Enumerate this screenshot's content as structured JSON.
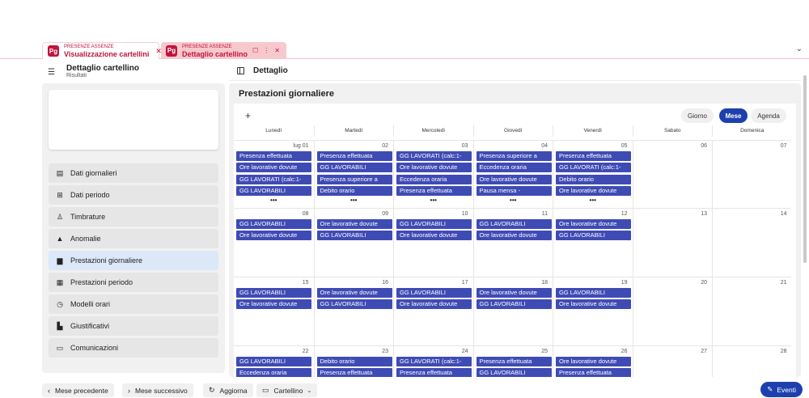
{
  "tabs": [
    {
      "sub": "PRESENZE ASSENZE",
      "main": "Visualizzazione cartellini",
      "logo": "Pg"
    },
    {
      "sub": "PRESENZE ASSENZE",
      "main": "Dettaglio cartellino",
      "logo": "Pg"
    }
  ],
  "header": {
    "title": "Dettaglio cartellino",
    "subtitle": "Risultati",
    "detail_title": "Dettaglio"
  },
  "sidebar": {
    "items": [
      {
        "label": "Dati giornalieri",
        "icon": "clipboard-icon",
        "glyph": "▤"
      },
      {
        "label": "Dati periodo",
        "icon": "table-icon",
        "glyph": "⊞"
      },
      {
        "label": "Timbrature",
        "icon": "person-badge-icon",
        "glyph": "♙"
      },
      {
        "label": "Anomalie",
        "icon": "warning-icon",
        "glyph": "▲"
      },
      {
        "label": "Prestazioni giornaliere",
        "icon": "document-icon",
        "glyph": "▆",
        "active": true
      },
      {
        "label": "Prestazioni periodo",
        "icon": "calendar-icon",
        "glyph": "▦"
      },
      {
        "label": "Modelli orari",
        "icon": "clock-calendar-icon",
        "glyph": "◷"
      },
      {
        "label": "Giustificativi",
        "icon": "file-check-icon",
        "glyph": "▙"
      },
      {
        "label": "Comunicazioni",
        "icon": "message-icon",
        "glyph": "▭"
      }
    ]
  },
  "main": {
    "title": "Prestazioni giornaliere",
    "views": [
      "Giorno",
      "Mese",
      "Agenda"
    ],
    "active_view": "Mese",
    "days_of_week": [
      "Lunedì",
      "Martedì",
      "Mercoledì",
      "Giovedì",
      "Venerdì",
      "Sabato",
      "Domenica"
    ],
    "weeks": [
      {
        "days": [
          {
            "num": "lug 01",
            "events": [
              "Presenza effettuata",
              "Ore lavorative dovute",
              "GG LAVORATI (calc:1-",
              "GG LAVORABILI"
            ],
            "more": "•••"
          },
          {
            "num": "02",
            "events": [
              "Presenza effettuata",
              "GG LAVORABILI",
              "Presenza superiore a",
              "Debito orario"
            ],
            "more": "•••"
          },
          {
            "num": "03",
            "events": [
              "GG LAVORATI (calc:1-",
              "Ore lavorative dovute",
              "Eccedenza oraria",
              "Presenza effettuata"
            ],
            "more": "•••"
          },
          {
            "num": "04",
            "events": [
              "Presenza superiore a",
              "Eccedenza oraria",
              "Ore lavorative dovute",
              "Pausa mensa -"
            ],
            "more": "•••"
          },
          {
            "num": "05",
            "events": [
              "Presenza effettuata",
              "GG LAVORATI (calc:1-",
              "Debito orario",
              "Ore lavorative dovute"
            ],
            "more": "•••"
          },
          {
            "num": "06",
            "events": []
          },
          {
            "num": "07",
            "events": []
          }
        ]
      },
      {
        "days": [
          {
            "num": "08",
            "events": [
              "GG LAVORABILI",
              "Ore lavorative dovute"
            ]
          },
          {
            "num": "09",
            "events": [
              "Ore lavorative dovute",
              "GG LAVORABILI"
            ]
          },
          {
            "num": "10",
            "events": [
              "GG LAVORABILI",
              "Ore lavorative dovute"
            ]
          },
          {
            "num": "11",
            "events": [
              "GG LAVORABILI",
              "Ore lavorative dovute"
            ]
          },
          {
            "num": "12",
            "events": [
              "Ore lavorative dovute",
              "GG LAVORABILI"
            ]
          },
          {
            "num": "13",
            "events": []
          },
          {
            "num": "14",
            "events": []
          }
        ]
      },
      {
        "days": [
          {
            "num": "15",
            "events": [
              "GG LAVORABILI",
              "Ore lavorative dovute"
            ]
          },
          {
            "num": "16",
            "events": [
              "Ore lavorative dovute",
              "GG LAVORABILI"
            ]
          },
          {
            "num": "17",
            "events": [
              "GG LAVORABILI",
              "Ore lavorative dovute"
            ]
          },
          {
            "num": "18",
            "events": [
              "Ore lavorative dovute",
              "GG LAVORABILI"
            ]
          },
          {
            "num": "19",
            "events": [
              "GG LAVORABILI",
              "Ore lavorative dovute"
            ]
          },
          {
            "num": "20",
            "events": []
          },
          {
            "num": "21",
            "events": []
          }
        ]
      },
      {
        "days": [
          {
            "num": "22",
            "events": [
              "GG LAVORABILI",
              "Eccedenza oraria"
            ]
          },
          {
            "num": "23",
            "events": [
              "Debito orario",
              "Presenza effettuata"
            ]
          },
          {
            "num": "24",
            "events": [
              "GG LAVORATI (calc:1-",
              "Presenza effettuata"
            ]
          },
          {
            "num": "25",
            "events": [
              "Presenza effettuata",
              "GG LAVORABILI"
            ]
          },
          {
            "num": "26",
            "events": [
              "Ore lavorative dovute",
              "Presenza effettuata"
            ]
          },
          {
            "num": "27",
            "events": []
          },
          {
            "num": "28",
            "events": []
          }
        ]
      }
    ]
  },
  "footer": {
    "prev": "Mese precedente",
    "next": "Mese successivo",
    "refresh": "Aggiorna",
    "cartellino": "Cartellino",
    "eventi": "Eventi"
  },
  "colors": {
    "event": "#3f4bb4",
    "accent": "#1e40af",
    "brand": "#c0143c"
  }
}
